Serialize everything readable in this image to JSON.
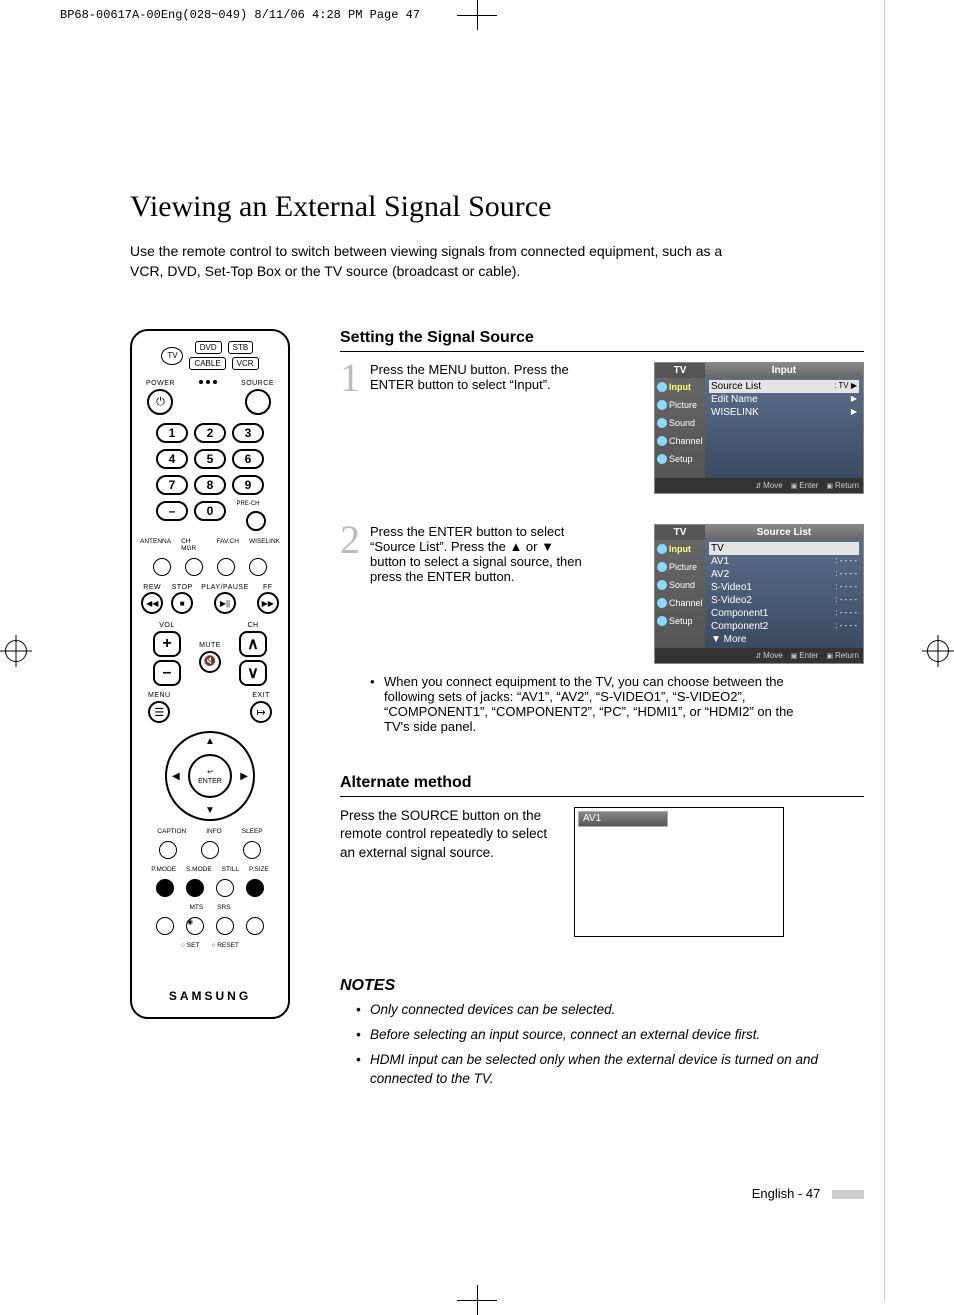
{
  "header": "BP68-00617A-00Eng(028~049)  8/11/06  4:28 PM  Page 47",
  "title": "Viewing an External Signal Source",
  "intro": "Use the remote control to switch between viewing signals from connected equipment, such as a VCR, DVD, Set-Top Box or the TV source (broadcast or cable).",
  "remote": {
    "devices_row1": [
      "DVD",
      "STB"
    ],
    "devices_row2": [
      "CABLE",
      "VCR"
    ],
    "tv_label": "TV",
    "power_label": "POWER",
    "source_label": "SOURCE",
    "numbers": [
      "1",
      "2",
      "3",
      "4",
      "5",
      "6",
      "7",
      "8",
      "9"
    ],
    "dash": "–",
    "zero": "0",
    "prech": "PRE-CH",
    "micro": [
      "ANTENNA",
      "CH MGR",
      "FAV.CH",
      "WISELINK"
    ],
    "transport": [
      "REW",
      "STOP",
      "PLAY/PAUSE",
      "FF"
    ],
    "transport_sym": [
      "◀◀",
      "■",
      "▶||",
      "▶▶"
    ],
    "vol": "VOL",
    "ch": "CH",
    "mute": "MUTE",
    "menu": "MENU",
    "exit": "EXIT",
    "enter": "ENTER",
    "enter_icon": "↩",
    "row1_labels": [
      "CAPTION",
      "INFO",
      "SLEEP"
    ],
    "row2_labels": [
      "P.MODE",
      "S.MODE",
      "STILL",
      "P.SIZE"
    ],
    "row3_labels": [
      "MTS",
      "SRS"
    ],
    "set_reset": [
      "○ SET",
      "○ RESET"
    ],
    "brand": "SAMSUNG"
  },
  "section1": {
    "title": "Setting the Signal Source",
    "step1_num": "1",
    "step1_text": "Press the MENU button. Press the ENTER button to select “Input”.",
    "step2_num": "2",
    "step2_text": "Press the ENTER button to select “Source List”. Press the ▲ or ▼ button to select a signal source, then press the ENTER button.",
    "step2_bullet": "When you connect equipment to the TV, you can choose between the following sets of jacks: “AV1”, “AV2”, “S-VIDEO1”, “S-VIDEO2”, “COMPONENT1”, “COMPONENT2”, “PC”, “HDMI1”, or “HDMI2” on the TV's side panel."
  },
  "osd1": {
    "brand": "TV",
    "title": "Input",
    "side": [
      {
        "label": "Input",
        "sel": true
      },
      {
        "label": "Picture",
        "sel": false
      },
      {
        "label": "Sound",
        "sel": false
      },
      {
        "label": "Channel",
        "sel": false
      },
      {
        "label": "Setup",
        "sel": false
      }
    ],
    "rows": [
      {
        "l": "Source List",
        "r": ": TV",
        "sel": true,
        "arrow": "▶"
      },
      {
        "l": "Edit Name",
        "r": "",
        "sel": false,
        "arrow": "▶"
      },
      {
        "l": "WISELINK",
        "r": "",
        "sel": false,
        "arrow": "▶"
      }
    ],
    "foot": {
      "move": "Move",
      "enter": "Enter",
      "ret": "Return"
    }
  },
  "osd2": {
    "brand": "TV",
    "title": "Source List",
    "side": [
      {
        "label": "Input",
        "sel": true
      },
      {
        "label": "Picture",
        "sel": false
      },
      {
        "label": "Sound",
        "sel": false
      },
      {
        "label": "Channel",
        "sel": false
      },
      {
        "label": "Setup",
        "sel": false
      }
    ],
    "rows": [
      {
        "l": "TV",
        "r": "",
        "sel": true
      },
      {
        "l": "AV1",
        "r": ": - - - -",
        "sel": false
      },
      {
        "l": "AV2",
        "r": ": - - - -",
        "sel": false
      },
      {
        "l": "S-Video1",
        "r": ": - - - -",
        "sel": false
      },
      {
        "l": "S-Video2",
        "r": ": - - - -",
        "sel": false
      },
      {
        "l": "Component1",
        "r": ": - - - -",
        "sel": false
      },
      {
        "l": "Component2",
        "r": ": - - - -",
        "sel": false
      },
      {
        "l": "▼ More",
        "r": "",
        "sel": false
      }
    ],
    "foot": {
      "move": "Move",
      "enter": "Enter",
      "ret": "Return"
    }
  },
  "section2": {
    "title": "Alternate method",
    "text": "Press the SOURCE button on the remote control repeatedly to select an external signal source.",
    "bar": "AV1"
  },
  "notes": {
    "title": "NOTES",
    "items": [
      "Only connected devices can be selected.",
      "Before selecting an input source, connect an external device first.",
      "HDMI input can be selected only when the external device is turned on and connected to the TV."
    ]
  },
  "footer": "English - 47"
}
